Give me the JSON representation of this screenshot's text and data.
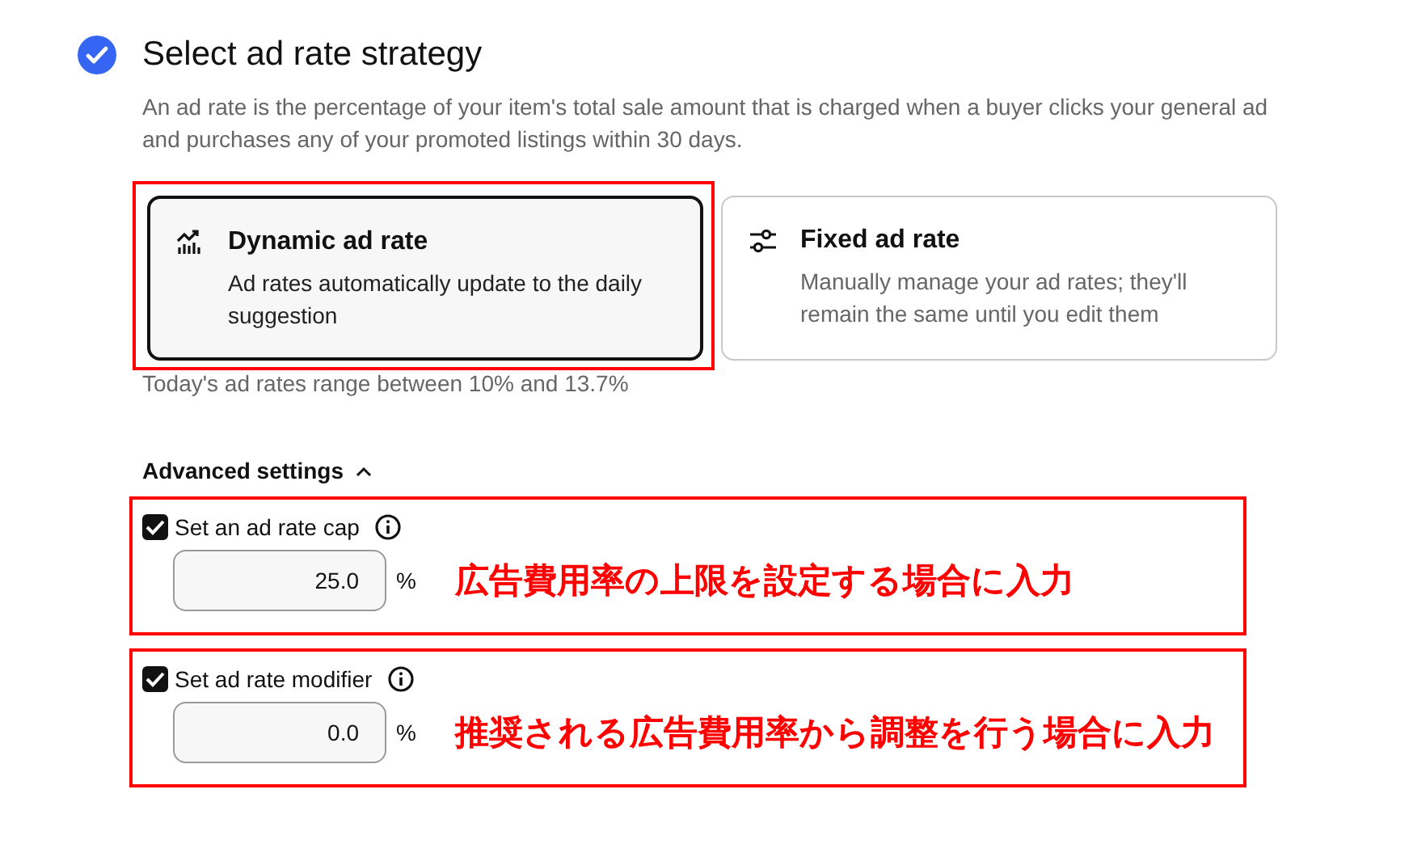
{
  "section": {
    "title": "Select ad rate strategy",
    "complete": true,
    "description": "An ad rate is the percentage of your item's total sale amount that is charged when a buyer clicks your general ad and purchases any of your promoted listings within 30 days."
  },
  "strategies": [
    {
      "kind": "dynamic",
      "title": "Dynamic ad rate",
      "description": "Ad rates automatically update to the daily suggestion",
      "selected": true,
      "highlighted": true
    },
    {
      "kind": "fixed",
      "title": "Fixed ad rate",
      "description": "Manually manage your ad rates; they'll remain the same until you edit them",
      "selected": false,
      "highlighted": false
    }
  ],
  "range_note": "Today's ad rates range between 10% and 13.7%",
  "advanced": {
    "label": "Advanced settings",
    "expanded": true,
    "settings": [
      {
        "label": "Set an ad rate cap",
        "checked": true,
        "value": "25.0",
        "unit": "%",
        "annotation": "広告費用率の上限を設定する場合に入力"
      },
      {
        "label": "Set ad rate modifier",
        "checked": true,
        "value": "0.0",
        "unit": "%",
        "annotation": "推奨される広告費用率から調整を行う場合に入力"
      }
    ]
  }
}
